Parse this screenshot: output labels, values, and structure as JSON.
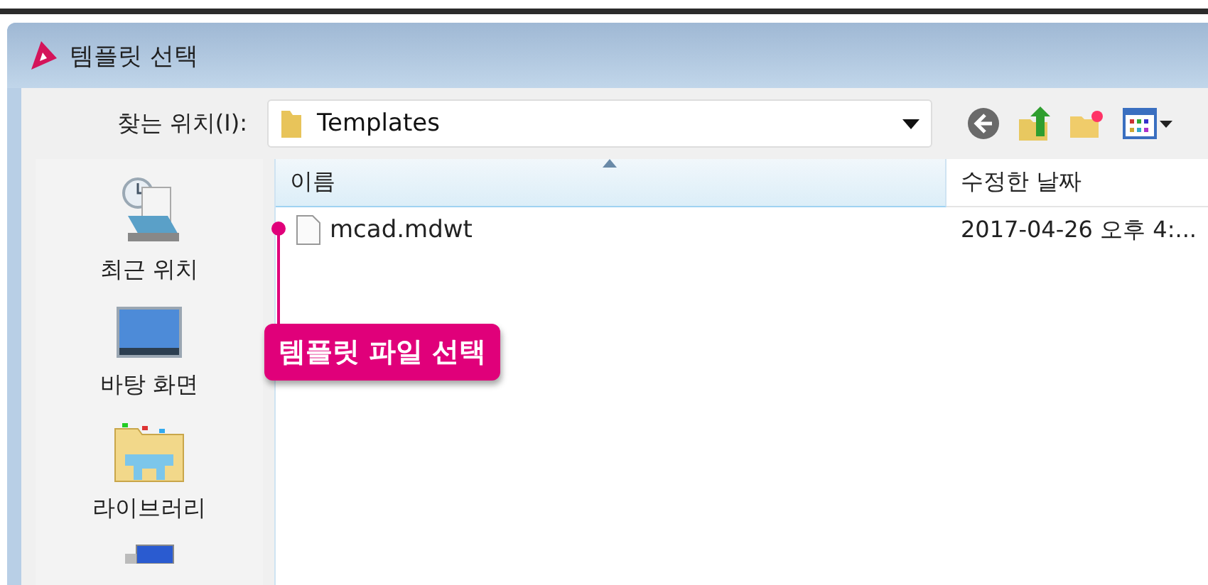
{
  "window": {
    "title": "템플릿 선택"
  },
  "look_in": {
    "label": "찾는 위치(I):",
    "value": "Templates"
  },
  "sidebar": {
    "items": [
      {
        "label": "최근 위치",
        "kind": "recent"
      },
      {
        "label": "바탕 화면",
        "kind": "desktop"
      },
      {
        "label": "라이브러리",
        "kind": "library"
      },
      {
        "kind": "computer"
      }
    ]
  },
  "table": {
    "columns": [
      {
        "label": "이름",
        "sorted": true
      },
      {
        "label": "수정한 날짜",
        "sorted": false
      }
    ],
    "rows": [
      {
        "name": "mcad.mdwt",
        "date": "2017-04-26 오후 4:..."
      }
    ]
  },
  "callout": {
    "text": "템플릿 파일 선택"
  }
}
